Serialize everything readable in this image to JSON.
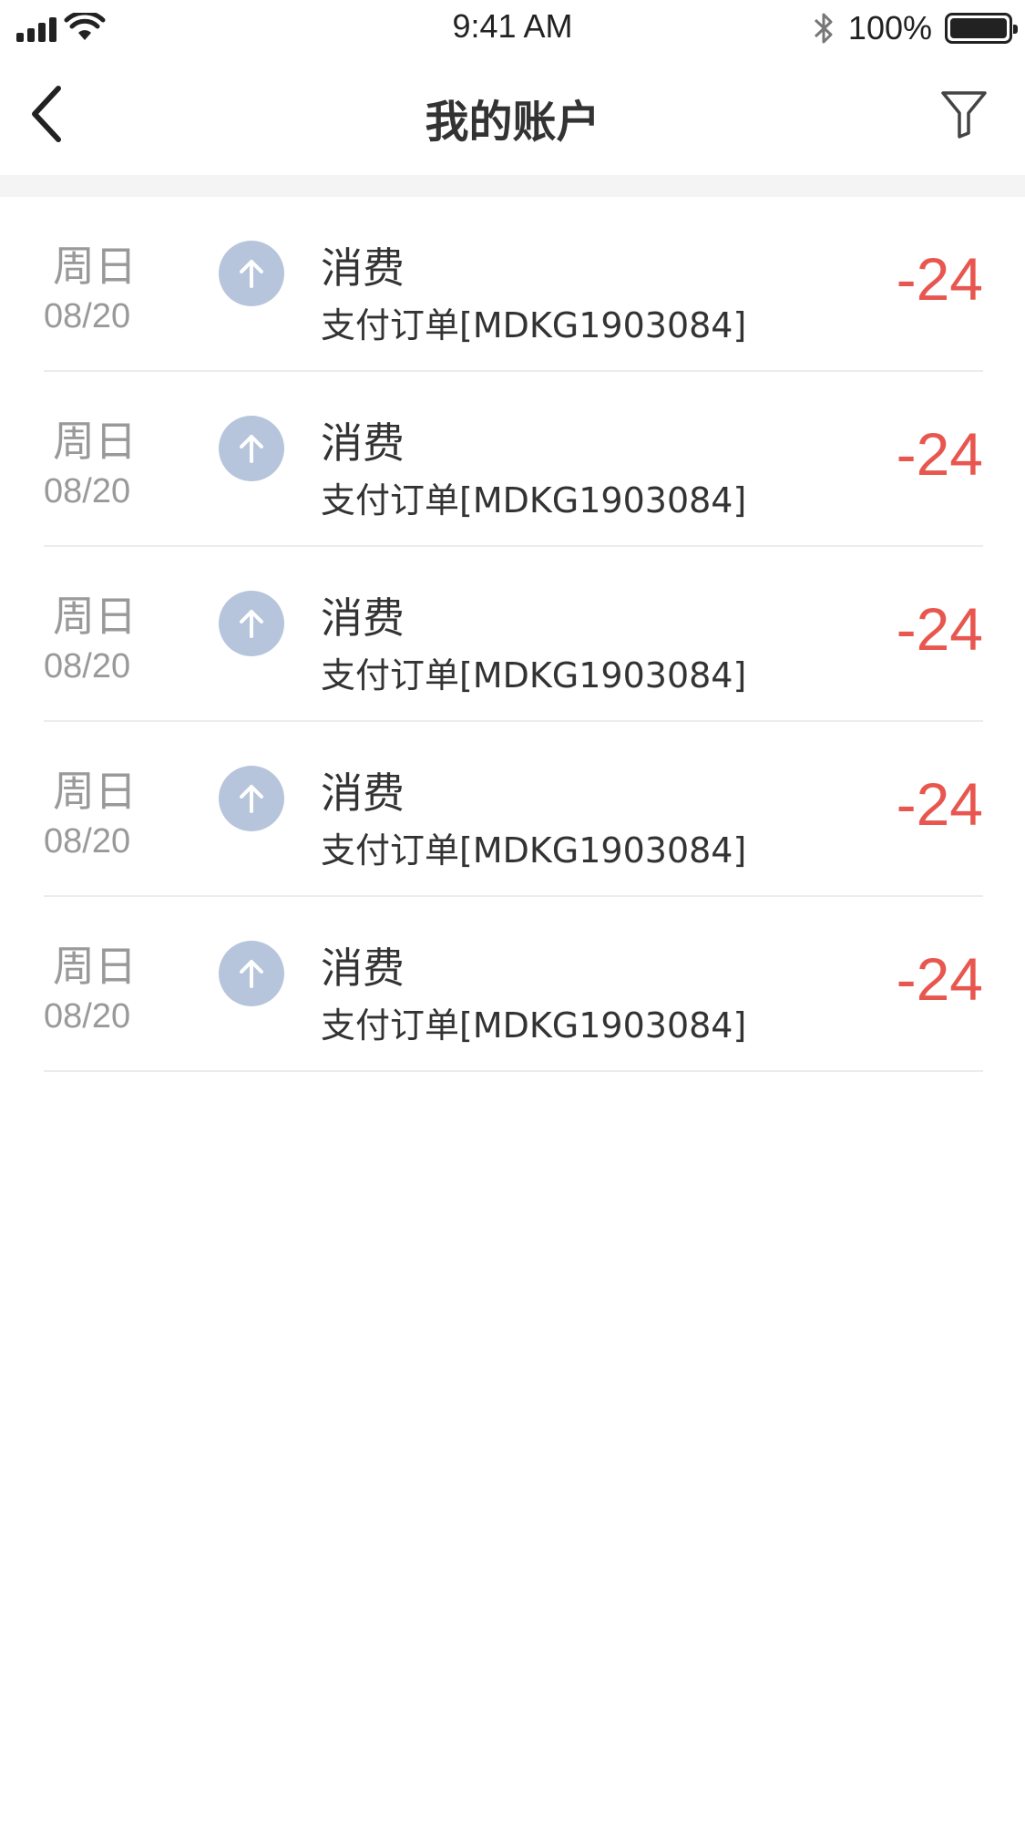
{
  "status_bar": {
    "time": "9:41 AM",
    "battery": "100%",
    "icons": [
      "signal-icon",
      "wifi-icon",
      "bluetooth-icon",
      "battery-icon"
    ]
  },
  "nav": {
    "title": "我的账户",
    "back_icon": "chevron-left-icon",
    "filter_icon": "filter-icon"
  },
  "transactions": [
    {
      "weekday": "周日",
      "date": "08/20",
      "title": "消费",
      "desc": "支付订单[MDKG1903084]",
      "amount": "-24",
      "icon": "arrow-up-icon"
    },
    {
      "weekday": "周日",
      "date": "08/20",
      "title": "消费",
      "desc": "支付订单[MDKG1903084]",
      "amount": "-24",
      "icon": "arrow-up-icon"
    },
    {
      "weekday": "周日",
      "date": "08/20",
      "title": "消费",
      "desc": "支付订单[MDKG1903084]",
      "amount": "-24",
      "icon": "arrow-up-icon"
    },
    {
      "weekday": "周日",
      "date": "08/20",
      "title": "消费",
      "desc": "支付订单[MDKG1903084]",
      "amount": "-24",
      "icon": "arrow-up-icon"
    },
    {
      "weekday": "周日",
      "date": "08/20",
      "title": "消费",
      "desc": "支付订单[MDKG1903084]",
      "amount": "-24",
      "icon": "arrow-up-icon"
    }
  ],
  "colors": {
    "amount": "#e8574f",
    "icon_bg": "#b6c5dc",
    "muted_text": "#999999"
  }
}
